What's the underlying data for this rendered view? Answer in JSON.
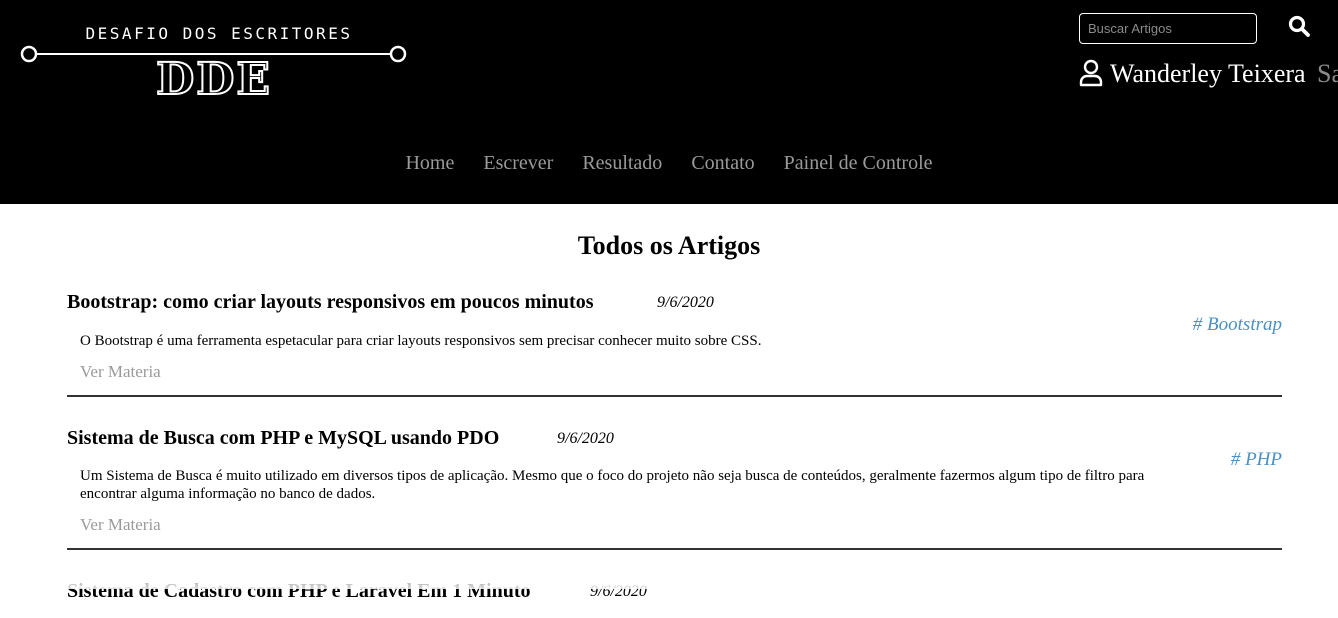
{
  "header": {
    "logo_sub": "DESAFIO DOS ESCRITORES",
    "logo_main": "DDE",
    "search_placeholder": "Buscar Artigos",
    "search_icon": "search-icon",
    "user_icon": "user-icon",
    "user_name": "Wanderley Teixera",
    "logout_label": "Sa"
  },
  "nav": {
    "items": [
      "Home",
      "Escrever",
      "Resultado",
      "Contato",
      "Painel de Controle"
    ]
  },
  "main": {
    "title": "Todos os Artigos",
    "articles": [
      {
        "title": "Bootstrap: como criar layouts responsivos em poucos minutos",
        "date": "9/6/2020",
        "tag": "# Bootstrap",
        "summary": "O Bootstrap é uma ferramenta espetacular para criar layouts responsivos sem precisar conhecer muito sobre CSS.",
        "more": "Ver Materia"
      },
      {
        "title": "Sistema de Busca com PHP e MySQL usando PDO",
        "date": "9/6/2020",
        "tag": "# PHP",
        "summary": "Um Sistema de Busca é muito utilizado em diversos tipos de aplicação. Mesmo que o foco do projeto não seja busca de conteúdos, geralmente fazermos algum tipo de filtro para encontrar alguma informação no banco de dados.",
        "more": "Ver Materia"
      },
      {
        "title": "Sistema de Cadastro com PHP e Laravel Em 1 Minuto",
        "date": "9/6/2020",
        "tag": "",
        "summary": "",
        "more": ""
      }
    ]
  },
  "colors": {
    "header_bg": "#000000",
    "nav_link": "#9a9a9a",
    "tag": "#4a90c2",
    "divider": "#333333"
  }
}
